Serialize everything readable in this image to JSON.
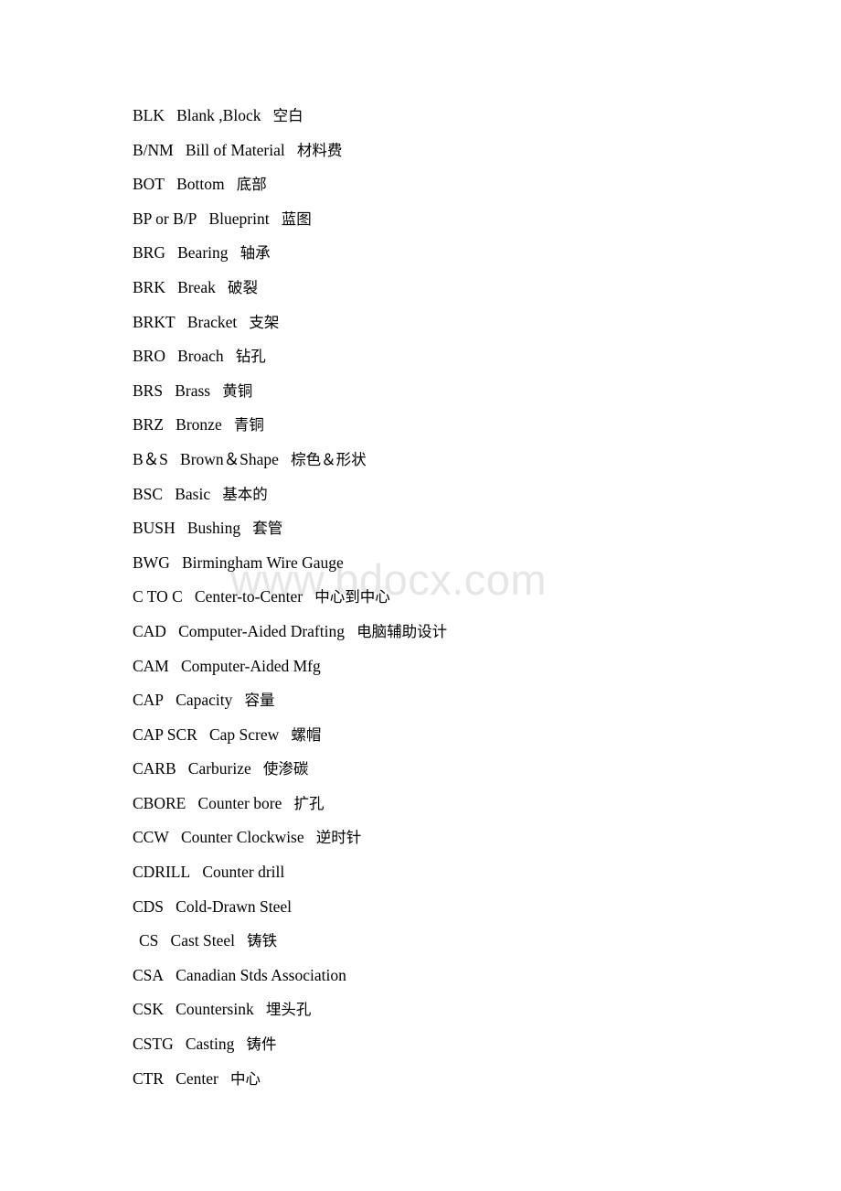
{
  "page": {
    "background_color": "#ffffff",
    "text_color": "#000000"
  },
  "watermark": {
    "text": "www.bdocx.com",
    "color": "#e6e6e6"
  },
  "glossary": {
    "entries": [
      {
        "abbr": "BLK",
        "english": "Blank ,Block",
        "chinese": "空白"
      },
      {
        "abbr": "B/NM",
        "english": "Bill of Material",
        "chinese": "材料费"
      },
      {
        "abbr": "BOT",
        "english": "Bottom",
        "chinese": "底部"
      },
      {
        "abbr": "BP or B/P",
        "english": "Blueprint",
        "chinese": "蓝图"
      },
      {
        "abbr": "BRG",
        "english": "Bearing",
        "chinese": "轴承"
      },
      {
        "abbr": "BRK",
        "english": "Break",
        "chinese": "破裂"
      },
      {
        "abbr": "BRKT",
        "english": "Bracket",
        "chinese": "支架"
      },
      {
        "abbr": "BRO",
        "english": "Broach",
        "chinese": "钻孔"
      },
      {
        "abbr": "BRS",
        "english": "Brass",
        "chinese": "黄铜"
      },
      {
        "abbr": "BRZ",
        "english": "Bronze",
        "chinese": "青铜"
      },
      {
        "abbr": "B＆S",
        "english": "Brown＆Shape",
        "chinese": "棕色＆形状"
      },
      {
        "abbr": "BSC",
        "english": "Basic",
        "chinese": "基本的"
      },
      {
        "abbr": "BUSH",
        "english": "Bushing",
        "chinese": "套管"
      },
      {
        "abbr": "BWG",
        "english": "Birmingham Wire Gauge",
        "chinese": ""
      },
      {
        "abbr": "C TO C",
        "english": "Center-to-Center",
        "chinese": "中心到中心"
      },
      {
        "abbr": "CAD",
        "english": "Computer-Aided Drafting",
        "chinese": "电脑辅助设计"
      },
      {
        "abbr": "CAM",
        "english": "Computer-Aided Mfg",
        "chinese": ""
      },
      {
        "abbr": "CAP",
        "english": "Capacity",
        "chinese": "容量"
      },
      {
        "abbr": "CAP SCR",
        "english": "Cap Screw",
        "chinese": "螺帽"
      },
      {
        "abbr": "CARB",
        "english": "Carburize",
        "chinese": "使渗碳"
      },
      {
        "abbr": "CBORE",
        "english": "Counter bore",
        "chinese": "扩孔"
      },
      {
        "abbr": "CCW",
        "english": "Counter Clockwise",
        "chinese": "逆时针"
      },
      {
        "abbr": "CDRILL",
        "english": "Counter drill",
        "chinese": ""
      },
      {
        "abbr": "CDS",
        "english": "Cold-Drawn Steel",
        "chinese": ""
      },
      {
        "abbr": "CS",
        "english": "Cast Steel",
        "chinese": "铸铁",
        "indent": true
      },
      {
        "abbr": "CSA",
        "english": "Canadian Stds Association",
        "chinese": ""
      },
      {
        "abbr": "CSK",
        "english": "Countersink",
        "chinese": "埋头孔"
      },
      {
        "abbr": "CSTG",
        "english": "Casting",
        "chinese": "铸件"
      },
      {
        "abbr": "CTR",
        "english": "Center",
        "chinese": "中心"
      }
    ]
  }
}
